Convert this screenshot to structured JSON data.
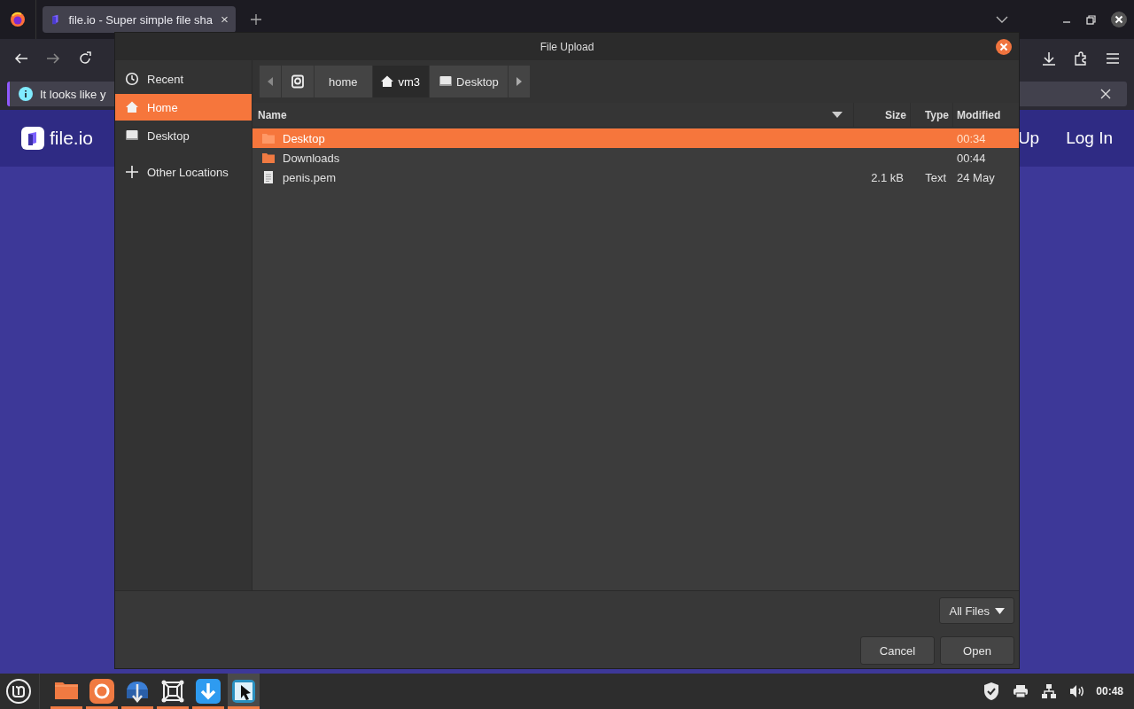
{
  "browser": {
    "tab": {
      "title": "file.io - Super simple file sha",
      "selected": true
    },
    "notification": {
      "text": "It looks like y"
    }
  },
  "site": {
    "logo": "file.io",
    "nav": [
      "Up",
      "Log In"
    ]
  },
  "dialog": {
    "title": "File Upload",
    "sidebar": [
      {
        "kind": "recent",
        "label": "Recent",
        "selected": false
      },
      {
        "kind": "home",
        "label": "Home",
        "selected": true
      },
      {
        "kind": "desktop",
        "label": "Desktop",
        "selected": false
      },
      {
        "kind": "other",
        "label": "Other Locations",
        "selected": false
      }
    ],
    "path": [
      {
        "kind": "drive",
        "selected": false
      },
      {
        "kind": "plain",
        "label": "home",
        "selected": false
      },
      {
        "kind": "home",
        "label": "vm3",
        "selected": true
      },
      {
        "kind": "desktop",
        "label": "Desktop",
        "selected": false
      }
    ],
    "columns": [
      "Name",
      "Size",
      "Type",
      "Modified"
    ],
    "rows": [
      {
        "kind": "folder",
        "name": "Desktop",
        "modified": "00:34",
        "selected": true
      },
      {
        "kind": "folder",
        "name": "Downloads",
        "modified": "00:44",
        "selected": false
      },
      {
        "kind": "file",
        "name": "penis.pem",
        "size": "2.1 kB",
        "type": "Text",
        "modified": "24 May",
        "selected": false
      }
    ],
    "filter": "All Files",
    "buttons": [
      "Cancel",
      "Open"
    ]
  },
  "taskbar": {
    "apps": [
      {
        "kind": "files",
        "selected": false
      },
      {
        "kind": "firefox",
        "selected": false
      },
      {
        "kind": "transfer",
        "selected": false
      },
      {
        "kind": "crop",
        "selected": false
      },
      {
        "kind": "download",
        "selected": false
      },
      {
        "kind": "screenshot",
        "selected": true
      }
    ],
    "clock": "00:48"
  }
}
